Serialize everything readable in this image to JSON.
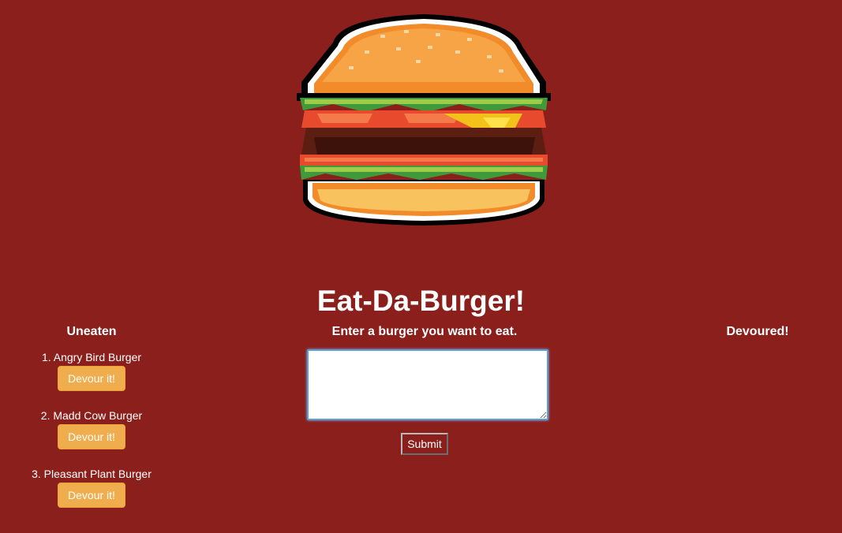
{
  "header": {
    "logo_icon": "pixel-burger-icon",
    "title": "Eat-Da-Burger!"
  },
  "uneaten": {
    "heading": "Uneaten",
    "items": [
      {
        "label": "1. Angry Bird Burger",
        "button": "Devour it!"
      },
      {
        "label": "2. Madd Cow Burger",
        "button": "Devour it!"
      },
      {
        "label": "3. Pleasant Plant Burger",
        "button": "Devour it!"
      }
    ]
  },
  "form": {
    "label": "Enter a burger you want to eat.",
    "input_value": "",
    "submit_label": "Submit"
  },
  "devoured": {
    "heading": "Devoured!",
    "items": []
  },
  "colors": {
    "background": "#8a1f1c",
    "devour_button": "#f0ad4e",
    "text": "#ffffff"
  }
}
